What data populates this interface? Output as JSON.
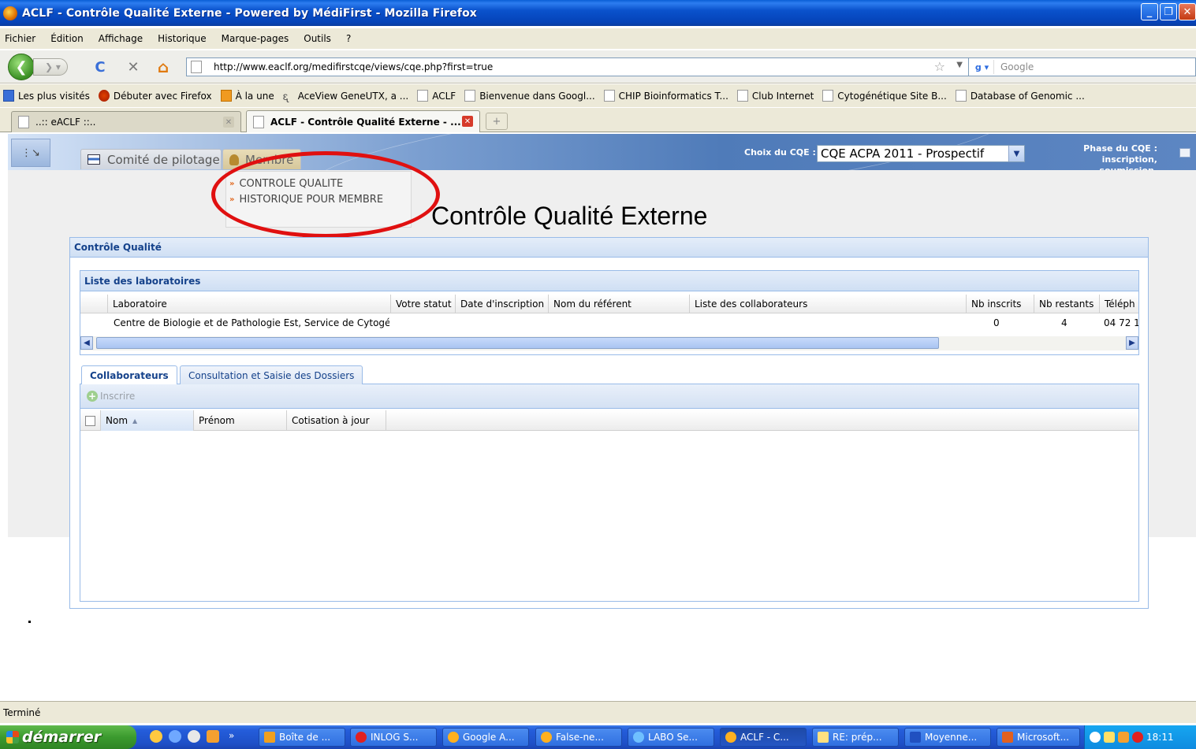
{
  "window": {
    "title": "ACLF - Contrôle Qualité Externe - Powered by MédiFirst - Mozilla Firefox",
    "buttons": [
      "_",
      "❐",
      "✕"
    ]
  },
  "menubar": [
    "Fichier",
    "Édition",
    "Affichage",
    "Historique",
    "Marque-pages",
    "Outils",
    "?"
  ],
  "navbar": {
    "url": "http://www.eaclf.org/medifirstcqe/views/cqe.php?first=true",
    "search_placeholder": "Google",
    "back_icon": "back-arrow-icon",
    "reload_icon": "C",
    "stop_icon": "✕",
    "home_icon": "⌂"
  },
  "bookmarks": [
    "Les plus visités",
    "Débuter avec Firefox",
    "À la une",
    "AceView GeneUTX, a ...",
    "ACLF",
    "Bienvenue dans Googl...",
    "CHIP Bioinformatics T...",
    "Club Internet",
    "Cytogénétique Site B...",
    "Database of Genomic ..."
  ],
  "browser_tabs": [
    {
      "label": "..:: eACLF ::..",
      "active": false
    },
    {
      "label": "ACLF - Contrôle Qualité Externe - ...",
      "active": true
    }
  ],
  "app": {
    "nav_tabs": [
      "Comité de pilotage",
      "Membre"
    ],
    "menu_items": [
      "CONTROLE QUALITE",
      "HISTORIQUE POUR MEMBRE"
    ],
    "cqe_label": "Choix du CQE :",
    "cqe_selected": "CQE ACPA 2011 - Prospectif",
    "phase_label": "Phase du CQE :",
    "phase_value": "inscription, soumission.",
    "page_title": "Contrôle Qualité Externe",
    "panel_title": "Contrôle Qualité",
    "labs": {
      "title": "Liste des laboratoires",
      "columns": [
        "Laboratoire",
        "Votre statut",
        "Date d'inscription",
        "Nom du référent",
        "Liste des collaborateurs",
        "Nb inscrits",
        "Nb restants",
        "Téléph"
      ],
      "rows": [
        {
          "laboratoire": "Centre de Biologie et de Pathologie Est, Service de Cytogénét",
          "statut": "",
          "date": "",
          "referent": "",
          "collaborateurs": "",
          "nb_inscrits": "0",
          "nb_restants": "4",
          "telephone": "04 72 1"
        }
      ]
    },
    "sub_tabs": [
      "Collaborateurs",
      "Consultation et Saisie des Dossiers"
    ],
    "toolbar_inscrire": "Inscrire",
    "collab_columns": [
      "Nom",
      "Prénom",
      "Cotisation à jour"
    ]
  },
  "statusbar": {
    "text": "Terminé"
  },
  "taskbar": {
    "start": "démarrer",
    "items": [
      "Boîte de ...",
      "INLOG S...",
      "Google A...",
      "False-ne...",
      "LABO Se...",
      "ACLF - C...",
      "RE: prép...",
      "Moyenne...",
      "Microsoft..."
    ],
    "clock": "18:11"
  }
}
